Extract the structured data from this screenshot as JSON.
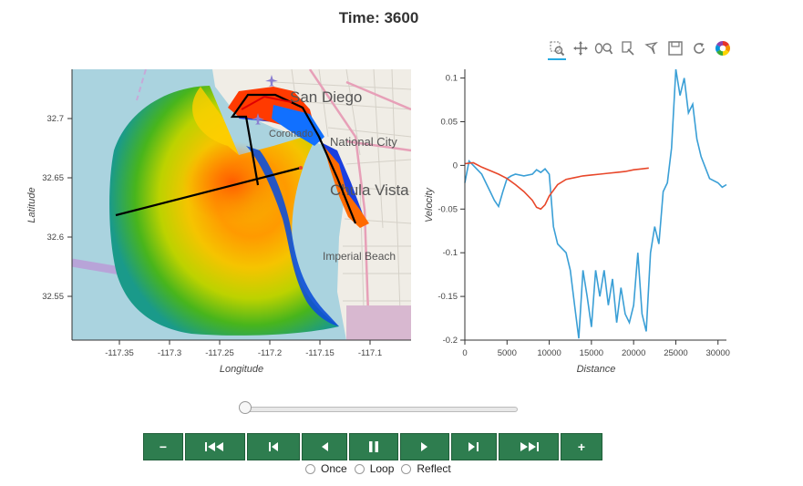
{
  "title": "Time: 3600",
  "toolbar": {
    "tools": [
      "box-zoom-icon",
      "pan-icon",
      "wheel-zoom-icon",
      "lasso-icon",
      "tap-icon",
      "save-icon",
      "reset-icon",
      "bokeh-logo-icon"
    ]
  },
  "map_panel": {
    "xlabel": "Longitude",
    "ylabel": "Latitude",
    "x_ticks": [
      "-117.35",
      "-117.3",
      "-117.25",
      "-117.2",
      "-117.15",
      "-117.1"
    ],
    "y_ticks": [
      "32.7",
      "32.65",
      "32.6",
      "32.55"
    ],
    "place_labels": [
      "San Diego",
      "Coronado",
      "National City",
      "Chula Vista",
      "Imperial Beach"
    ]
  },
  "chart_data": {
    "type": "line",
    "xlabel": "Distance",
    "ylabel": "Velocity",
    "xlim": [
      0,
      31000
    ],
    "ylim": [
      -0.2,
      0.11
    ],
    "x_ticks": [
      "0",
      "5000",
      "10000",
      "15000",
      "20000",
      "25000",
      "30000"
    ],
    "y_ticks": [
      "0.1",
      "0.05",
      "0",
      "-0.05",
      "-0.1",
      "-0.15",
      "-0.2"
    ],
    "series": [
      {
        "color": "#3a9fd6",
        "x": [
          0,
          500,
          1000,
          1500,
          2000,
          2500,
          3000,
          3500,
          4000,
          4500,
          5000,
          5500,
          6000,
          7000,
          8000,
          8500,
          9000,
          9500,
          10000,
          10500,
          11000,
          11500,
          12000,
          12500,
          13000,
          13500,
          14000,
          14500,
          15000,
          15500,
          16000,
          16500,
          17000,
          17500,
          18000,
          18500,
          19000,
          19500,
          20000,
          20500,
          21000,
          21500,
          22000,
          22500,
          23000,
          23500,
          24000,
          24500,
          25000,
          25500,
          26000,
          26500,
          27000,
          27500,
          28000,
          29000,
          30000,
          30500,
          31000
        ],
        "values": [
          -0.02,
          0.005,
          0.0,
          -0.005,
          -0.01,
          -0.02,
          -0.03,
          -0.04,
          -0.047,
          -0.03,
          -0.015,
          -0.012,
          -0.01,
          -0.012,
          -0.01,
          -0.005,
          -0.008,
          -0.004,
          -0.01,
          -0.07,
          -0.09,
          -0.095,
          -0.1,
          -0.12,
          -0.16,
          -0.198,
          -0.12,
          -0.15,
          -0.185,
          -0.12,
          -0.15,
          -0.12,
          -0.16,
          -0.13,
          -0.18,
          -0.14,
          -0.17,
          -0.18,
          -0.16,
          -0.1,
          -0.17,
          -0.19,
          -0.1,
          -0.07,
          -0.09,
          -0.03,
          -0.02,
          0.02,
          0.11,
          0.08,
          0.1,
          0.06,
          0.07,
          0.03,
          0.01,
          -0.015,
          -0.02,
          -0.025,
          -0.022
        ]
      },
      {
        "color": "#e8472a",
        "x": [
          0,
          1000,
          2000,
          3000,
          4000,
          5000,
          6000,
          7000,
          8000,
          8500,
          9000,
          9500,
          10000,
          11000,
          12000,
          13000,
          14000,
          15000,
          16000,
          17000,
          18000,
          19000,
          20000,
          21000,
          21800
        ],
        "values": [
          0.002,
          0.003,
          -0.002,
          -0.006,
          -0.01,
          -0.015,
          -0.022,
          -0.03,
          -0.04,
          -0.048,
          -0.05,
          -0.045,
          -0.035,
          -0.022,
          -0.016,
          -0.014,
          -0.012,
          -0.011,
          -0.01,
          -0.009,
          -0.008,
          -0.007,
          -0.005,
          -0.004,
          -0.003
        ]
      }
    ]
  },
  "player": {
    "slider_value": 0,
    "buttons": [
      "−",
      "⏮",
      "⏪",
      "◀",
      "⏸",
      "▶",
      "⏩",
      "⏭",
      "+"
    ],
    "loop_options": [
      "Once",
      "Loop",
      "Reflect"
    ]
  }
}
